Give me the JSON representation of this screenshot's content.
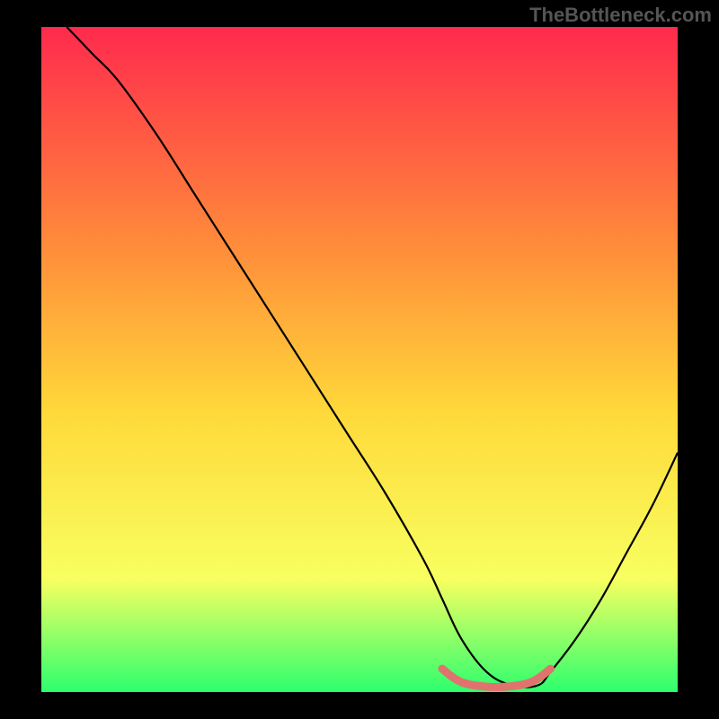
{
  "watermark": "TheBottleneck.com",
  "chart_data": {
    "type": "line",
    "title": "",
    "xlabel": "",
    "ylabel": "",
    "xlim": [
      0,
      100
    ],
    "ylim": [
      0,
      100
    ],
    "background_gradient": {
      "top": "#ff2a4d",
      "mid_upper": "#ff8c3a",
      "mid": "#ffd93a",
      "mid_lower": "#f8ff60",
      "bottom": "#2dff6e"
    },
    "series": [
      {
        "name": "curve",
        "color": "#000000",
        "x": [
          4,
          8,
          12,
          18,
          24,
          30,
          36,
          42,
          48,
          54,
          60,
          63,
          66,
          70,
          74,
          78,
          80,
          84,
          88,
          92,
          96,
          100
        ],
        "y": [
          100,
          96,
          92,
          84,
          75,
          66,
          57,
          48,
          39,
          30,
          20,
          14,
          8,
          3,
          1,
          1,
          3,
          8,
          14,
          21,
          28,
          36
        ]
      },
      {
        "name": "highlight-band",
        "color": "#e0736d",
        "x": [
          63,
          65,
          67,
          70,
          73,
          76,
          78,
          80
        ],
        "y": [
          3.5,
          2,
          1.2,
          0.8,
          0.8,
          1.2,
          2,
          3.5
        ]
      }
    ]
  }
}
